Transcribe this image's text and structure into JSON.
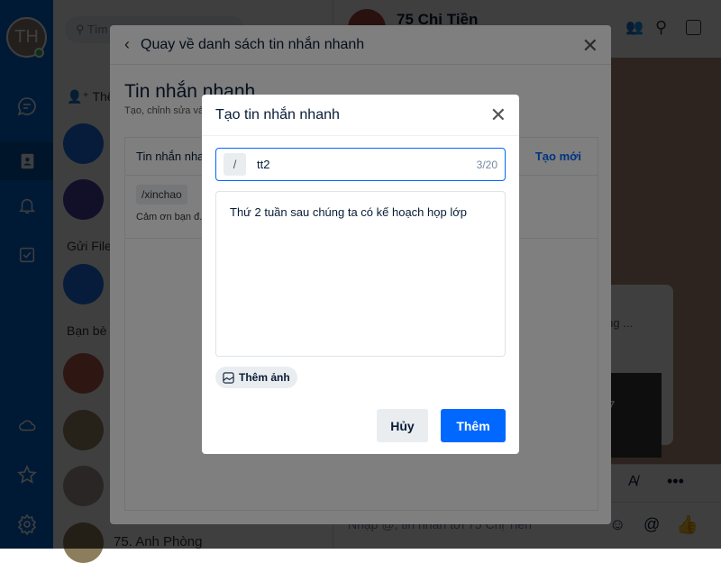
{
  "user": {
    "initials": "TH"
  },
  "contacts": {
    "search_placeholder": "Tìm",
    "add_friend_label": "Thêm bạn",
    "send_file_label": "Gửi File",
    "friends_section": "Bạn bè",
    "last_contact": "75. Anh Phòng"
  },
  "chat": {
    "name": "75 Chị Tiền",
    "preview_text": "những ...",
    "photo_more": "+7",
    "input_placeholder": "Nhập @, tin nhắn tới 75 Chị Tiền"
  },
  "outer_modal": {
    "back_label": "Quay về danh sách tin nhắn nhanh",
    "title": "Tin nhắn nhanh",
    "subtitle": "Tạo, chỉnh sửa và ... điện thoại.",
    "column_header": "Tin nhắn nhanh",
    "create_new": "Tạo mới",
    "items": [
      {
        "shortcut": "/xinchao",
        "text": "Cảm ơn bạn đ..."
      }
    ]
  },
  "inner_modal": {
    "title": "Tạo tin nhắn nhanh",
    "prefix": "/",
    "shortcut_value": "tt2",
    "counter": "3/20",
    "content_value": "Thứ 2 tuần sau chúng ta có kế hoạch họp lớp",
    "add_image_label": "Thêm ảnh",
    "cancel_label": "Hủy",
    "submit_label": "Thêm"
  },
  "colors": {
    "accent": "#0068ff",
    "sidebar": "#0068d4"
  }
}
